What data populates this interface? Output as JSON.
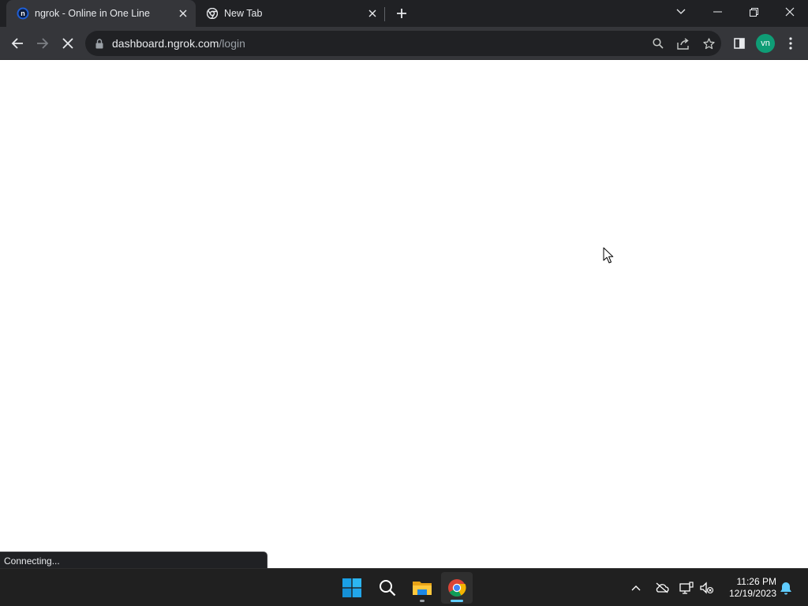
{
  "browser": {
    "tabs": [
      {
        "title": "ngrok - Online in One Line",
        "favicon": "ngrok-favicon-icon",
        "active": true
      },
      {
        "title": "New Tab",
        "favicon": "chrome-icon",
        "active": false
      }
    ],
    "address": {
      "host": "dashboard.ngrok.com",
      "path": "/login"
    },
    "profile_initials": "vn",
    "profile_color": "#0f9d76",
    "loading": true
  },
  "content": {
    "status_text": "Connecting..."
  },
  "taskbar": {
    "apps": [
      {
        "name": "windows-start-icon"
      },
      {
        "name": "search-icon"
      },
      {
        "name": "file-explorer-icon"
      },
      {
        "name": "chrome-icon",
        "active": true
      }
    ],
    "clock": {
      "time": "11:26 PM",
      "date": "12/19/2023"
    }
  },
  "colors": {
    "tabstrip_bg": "#202124",
    "toolbar_bg": "#35363a",
    "taskbar_bg": "#202020",
    "accent": "#60cdff"
  }
}
